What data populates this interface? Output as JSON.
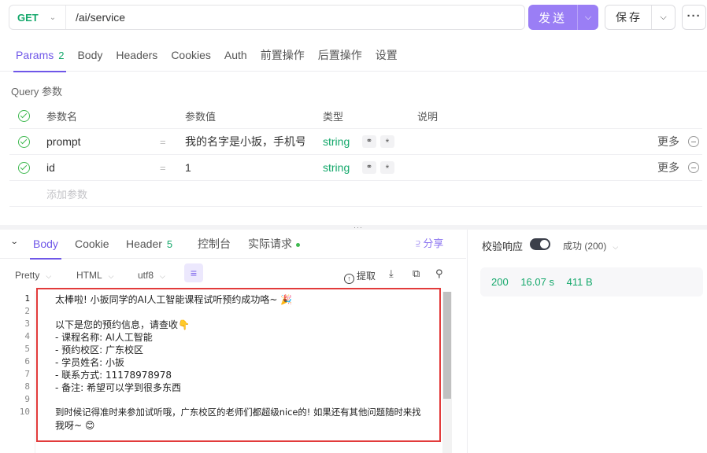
{
  "request": {
    "method": "GET",
    "url": "/ai/service",
    "send_label": "发送",
    "save_label": "保存",
    "more_label": "···"
  },
  "req_tabs": [
    {
      "label": "Params",
      "count": "2"
    },
    {
      "label": "Body"
    },
    {
      "label": "Headers"
    },
    {
      "label": "Cookies"
    },
    {
      "label": "Auth"
    },
    {
      "label": "前置操作"
    },
    {
      "label": "后置操作"
    },
    {
      "label": "设置"
    }
  ],
  "query": {
    "title": "Query 参数",
    "headers": {
      "name": "参数名",
      "value": "参数值",
      "type": "类型",
      "desc": "说明"
    },
    "rows": [
      {
        "name": "prompt",
        "eq": "=",
        "value": "我的名字是小扳，手机号",
        "type": "string",
        "more": "更多"
      },
      {
        "name": "id",
        "eq": "=",
        "value": "1",
        "type": "string",
        "more": "更多"
      }
    ],
    "add_placeholder": "添加参数"
  },
  "resp_tabs": {
    "body": "Body",
    "cookie": "Cookie",
    "header": "Header",
    "header_count": "5",
    "console": "控制台",
    "actual": "实际请求",
    "share": "分享"
  },
  "resp_toolbar": {
    "format": "Pretty",
    "lang": "HTML",
    "encoding": "utf8",
    "extract": "提取"
  },
  "code_lines": [
    {
      "n": "1",
      "text": "太棒啦! 小扳同学的AI人工智能课程试听预约成功咯~ 🎉"
    },
    {
      "n": "2",
      "text": ""
    },
    {
      "n": "3",
      "text": "以下是您的预约信息，请查收👇"
    },
    {
      "n": "4",
      "text": "- 课程名称: AI人工智能"
    },
    {
      "n": "5",
      "text": "- 预约校区: 广东校区"
    },
    {
      "n": "6",
      "text": "- 学员姓名: 小扳"
    },
    {
      "n": "7",
      "text": "- 联系方式: 11178978978"
    },
    {
      "n": "8",
      "text": "- 备注: 希望可以学到很多东西"
    },
    {
      "n": "9",
      "text": ""
    },
    {
      "n": "10",
      "text": "到时候记得准时来参加试听哦，广东校区的老师们都超级nice的! 如果还有其他问题随时来找"
    },
    {
      "n": "",
      "text": "我呀~ 😊"
    }
  ],
  "right_panel": {
    "verify_label": "校验响应",
    "status_select": "成功 (200)",
    "status_code": "200",
    "time": "16.07 s",
    "size": "411 B"
  }
}
